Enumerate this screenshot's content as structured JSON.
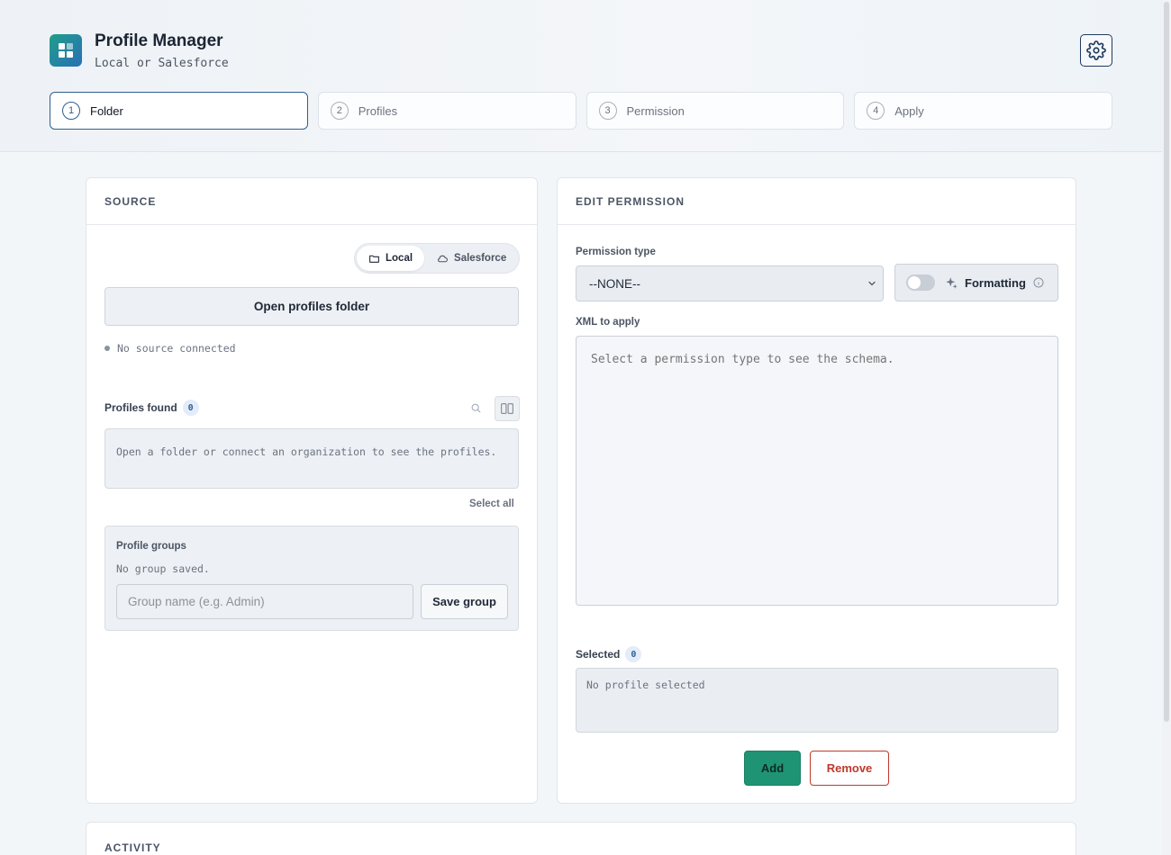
{
  "app": {
    "title": "Profile Manager",
    "subtitle": "Local or Salesforce",
    "brand_colors": {
      "accent": "#2f5f8f",
      "primary": "#1f9474",
      "danger": "#c0392b"
    }
  },
  "steps": [
    {
      "num": "1",
      "label": "Folder"
    },
    {
      "num": "2",
      "label": "Profiles"
    },
    {
      "num": "3",
      "label": "Permission"
    },
    {
      "num": "4",
      "label": "Apply"
    }
  ],
  "source": {
    "heading": "SOURCE",
    "toggle": {
      "local": "Local",
      "salesforce": "Salesforce"
    },
    "open_button": "Open profiles folder",
    "status": "No source connected",
    "profiles_found_label": "Profiles found",
    "profiles_count": "0",
    "empty_text": "Open a folder or connect an organization to see the profiles.",
    "select_all": "Select all",
    "groups": {
      "title": "Profile groups",
      "empty": "No group saved.",
      "input_placeholder": "Group name (e.g. Admin)",
      "save_button": "Save group"
    }
  },
  "edit": {
    "heading": "EDIT PERMISSION",
    "permission_type_label": "Permission type",
    "permission_type_value": "--NONE--",
    "formatting_label": "Formatting",
    "xml_label": "XML to apply",
    "xml_placeholder": "Select a permission type to see the schema.",
    "selected_label": "Selected",
    "selected_count": "0",
    "selected_empty": "No profile selected",
    "add_button": "Add",
    "remove_button": "Remove"
  },
  "activity": {
    "heading": "ACTIVITY"
  }
}
